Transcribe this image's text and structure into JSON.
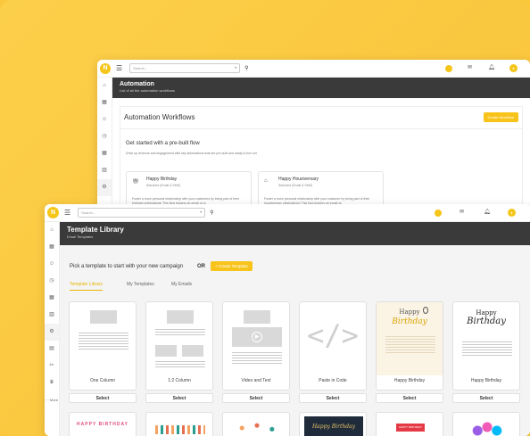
{
  "back_window": {
    "search_placeholder": "Search...",
    "header_title": "Automation",
    "header_subtitle": "List of all the automation workflows",
    "panel_title": "Automation Workflows",
    "create_button": "Create Workflow",
    "section_title": "Get started with a pre-built flow",
    "section_desc": "Drive up revenue and engagement with key automations that are pre-built and ready to turn on!",
    "flows": [
      {
        "title": "Happy Birthday",
        "subtitle": "Standard (Email & SMS)",
        "desc": "Foster a more personal relationship with your customers by being part of their birthday celebrations! This flow triggers an email on a"
      },
      {
        "title": "Happy Housiversary",
        "subtitle": "Standard (Email & SMS)",
        "desc": "Foster a more personal relationship with your customer by being part of their housiversary celebrations! This flow triggers an email on"
      }
    ]
  },
  "front_window": {
    "search_placeholder": "Search...",
    "header_title": "Template Library",
    "header_subtitle": "Email Templates",
    "prompt": "Pick a template to start with your new campaign",
    "or_text": "OR",
    "create_button": "+ Create Template",
    "tabs": [
      "Template Library",
      "My Templates",
      "My Emails"
    ],
    "templates": [
      "One Column",
      "1:2 Column",
      "Video and Text",
      "Paste in Code",
      "Happy Birthday",
      "Happy Birthday"
    ],
    "select_label": "Select",
    "more_label": "More",
    "row2_texts": [
      "HAPPY BIRTHDAY",
      "",
      "",
      "",
      "HAPPY BIRTHDAY",
      ""
    ],
    "card_texts": {
      "happy_birthday_1": "Happy Birthday",
      "happy_birthday_2": "Happy Birthday",
      "happy_word": "Happy",
      "birthday_word": "Birthday"
    }
  },
  "colors": {
    "accent": "#f8c41c",
    "header": "#3a3a3a",
    "background": "#fbc83b"
  }
}
